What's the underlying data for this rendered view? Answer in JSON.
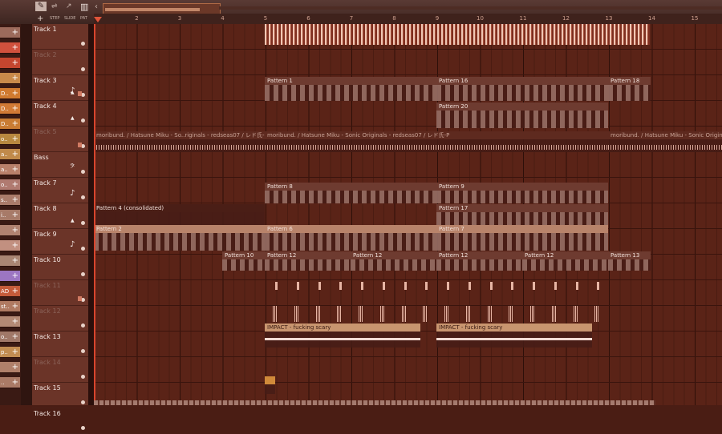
{
  "toolbar": {
    "buttons": [
      "STEP",
      "SLIDE",
      "PAT"
    ],
    "overview_text": "............"
  },
  "ruler": {
    "bars": [
      "2",
      "3",
      "4",
      "5",
      "6",
      "7",
      "8",
      "9",
      "10",
      "11",
      "12",
      "13",
      "14",
      "15"
    ]
  },
  "channels": [
    {
      "label": "",
      "color": "#9c6a5b"
    },
    {
      "label": "",
      "color": "#d0513d"
    },
    {
      "label": "",
      "color": "#c4462f"
    },
    {
      "label": "",
      "color": "#c98a4a"
    },
    {
      "label": "D..",
      "color": "#d07a2f"
    },
    {
      "label": "D..",
      "color": "#d27a35"
    },
    {
      "label": "D..",
      "color": "#c97c33"
    },
    {
      "label": "o..",
      "color": "#b8883f"
    },
    {
      "label": "a..",
      "color": "#c08a4a"
    },
    {
      "label": "a..",
      "color": "#b8806a"
    },
    {
      "label": "o..",
      "color": "#b07a70"
    },
    {
      "label": "s..",
      "color": "#aa7b6a"
    },
    {
      "label": "i..",
      "color": "#a77a68"
    },
    {
      "label": "",
      "color": "#b08270"
    },
    {
      "label": "",
      "color": "#c29080"
    },
    {
      "label": "",
      "color": "#a98573"
    },
    {
      "label": "",
      "color": "#9c76c2"
    },
    {
      "label": "AD",
      "color": "#c55b3a"
    },
    {
      "label": "st..",
      "color": "#b07a62"
    },
    {
      "label": "",
      "color": "#b48a75"
    },
    {
      "label": "o..",
      "color": "#a07868"
    },
    {
      "label": "p..",
      "color": "#c28d52"
    },
    {
      "label": "",
      "color": "#b0806a"
    },
    {
      "label": "..",
      "color": "#aa7a66"
    }
  ],
  "tracks": [
    {
      "name": "Track 1",
      "muted": false
    },
    {
      "name": "Track 2",
      "muted": true
    },
    {
      "name": "Track 3",
      "muted": false
    },
    {
      "name": "Track 4",
      "muted": false
    },
    {
      "name": "Track 5",
      "muted": true
    },
    {
      "name": "Bass",
      "muted": false
    },
    {
      "name": "Track 7",
      "muted": false
    },
    {
      "name": "Track 8",
      "muted": false
    },
    {
      "name": "Track 9",
      "muted": false
    },
    {
      "name": "Track 10",
      "muted": false
    },
    {
      "name": "Track 11",
      "muted": true
    },
    {
      "name": "Track 12",
      "muted": true
    },
    {
      "name": "Track 13",
      "muted": false
    },
    {
      "name": "Track 14",
      "muted": true
    },
    {
      "name": "Track 15",
      "muted": false
    },
    {
      "name": "Track 16",
      "muted": false
    }
  ],
  "clips": {
    "pattern1": "Pattern 1",
    "pattern16": "Pattern 16",
    "pattern18": "Pattern 18",
    "pattern20": "Pattern 20",
    "audio5a": "moribund. / Hatsune Miku - So..riginals - redseas07 / レド氏-P",
    "audio5b": "moribund. / Hatsune Miku - Sonic Originals - redseas07 / レド氏-P",
    "audio5c": "moribund. / Hatsune Miku - Sonic Originals",
    "pattern8": "Pattern 8",
    "pattern9": "Pattern 9",
    "pattern17": "Pattern 17",
    "pattern4": "Pattern 4 (consolidated)",
    "pattern2": "Pattern 2",
    "pattern6": "Pattern 6",
    "pattern7": "Pattern 7",
    "pattern10": "Pattern 10",
    "pattern12": "Pattern 12",
    "pattern13": "Pattern 13",
    "impact": "IMPACT - fucking scary"
  }
}
